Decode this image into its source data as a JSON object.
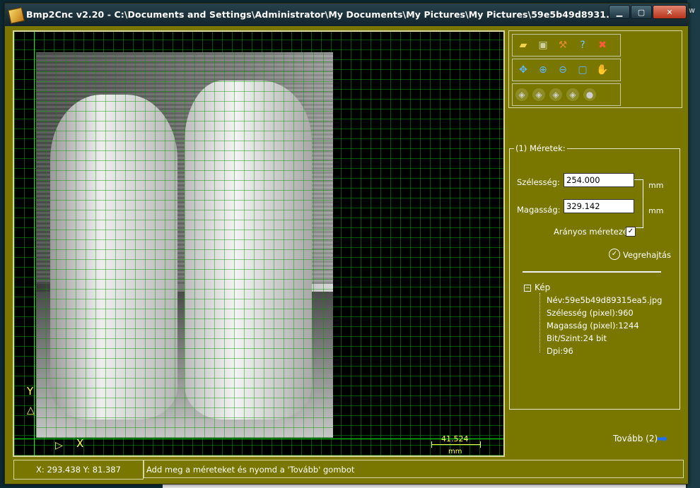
{
  "window": {
    "title": "Bmp2Cnc v2.20 - C:\\Documents and Settings\\Administrator\\My Documents\\My Pictures\\My Pictures\\59e5b49d8931...",
    "minimize_icon": "minimize-icon",
    "maximize_icon": "maximize-icon",
    "close_icon": "close-icon"
  },
  "desktop": {
    "edge_text": "w"
  },
  "canvas": {
    "axis_x_label": "X",
    "axis_y_label": "Y",
    "scale_value": "41.524",
    "scale_unit": "mm"
  },
  "toolbar": {
    "row1": [
      "open-icon",
      "save-icon",
      "tool-icon",
      "help-icon",
      "exit-icon"
    ],
    "row2": [
      "move-icon",
      "zoom-in-icon",
      "zoom-out-icon",
      "zoom-fit-icon",
      "pan-hand-icon"
    ],
    "row3": [
      "view-3d-1-icon",
      "view-3d-2-icon",
      "view-3d-3-icon",
      "view-3d-4-icon",
      "sphere-icon"
    ]
  },
  "panel": {
    "group_title": "(1) Méretek:",
    "width_label": "Szélesség:",
    "width_value": "254.000",
    "height_label": "Magasság:",
    "height_value": "329.142",
    "unit1": "mm",
    "unit2": "mm",
    "proportional_label": "Arányos méretezés:",
    "proportional_checked": true,
    "execute_label": "Vegrehajtás",
    "tree": {
      "root": "Kép",
      "items": [
        "Név:59e5b49d89315ea5.jpg",
        "Szélesség (pixel):960",
        "Magasság (pixel):1244",
        "Bit/Szint:24 bit",
        "Dpi:96"
      ]
    }
  },
  "next_label": "Tovább (2)",
  "status": {
    "coords": "X: 293.438 Y: 81.387",
    "message": "Add meg a méreteket és nyomd a 'Tovább' gombot"
  }
}
